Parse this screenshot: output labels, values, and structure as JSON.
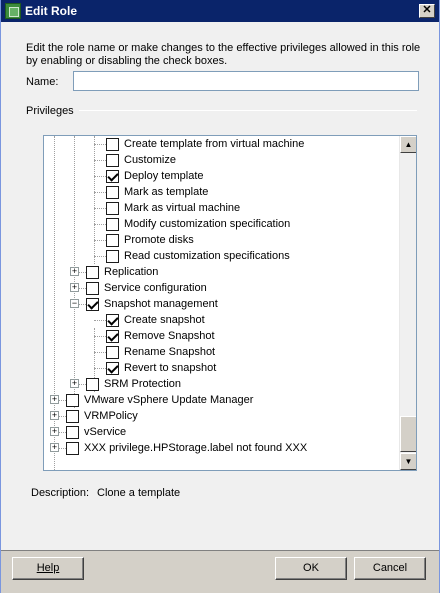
{
  "window": {
    "title": "Edit Role",
    "close_glyph": "✕"
  },
  "intro_text": "Edit the role name or make changes to the effective privileges allowed in this role by enabling or disabling the check boxes.",
  "name_field": {
    "label": "Name:",
    "value": ""
  },
  "privileges_label": "Privileges",
  "tree": {
    "items": [
      {
        "label": "Create template from virtual machine",
        "checked": false
      },
      {
        "label": "Customize",
        "checked": false
      },
      {
        "label": "Deploy template",
        "checked": true
      },
      {
        "label": "Mark as template",
        "checked": false
      },
      {
        "label": "Mark as virtual machine",
        "checked": false
      },
      {
        "label": "Modify customization specification",
        "checked": false
      },
      {
        "label": "Promote disks",
        "checked": false
      },
      {
        "label": "Read customization specifications",
        "checked": false
      },
      {
        "label": "Replication",
        "checked": false,
        "expander": "+"
      },
      {
        "label": "Service configuration",
        "checked": false,
        "expander": "+"
      },
      {
        "label": "Snapshot management",
        "checked": true,
        "expander": "−"
      },
      {
        "label": "Create snapshot",
        "checked": true
      },
      {
        "label": "Remove Snapshot",
        "checked": true
      },
      {
        "label": "Rename Snapshot",
        "checked": false
      },
      {
        "label": "Revert to snapshot",
        "checked": true
      },
      {
        "label": "SRM Protection",
        "checked": false,
        "expander": "+"
      },
      {
        "label": "VMware vSphere Update Manager",
        "checked": false,
        "expander": "+"
      },
      {
        "label": "VRMPolicy",
        "checked": false,
        "expander": "+"
      },
      {
        "label": "vService",
        "checked": false,
        "expander": "+"
      },
      {
        "label": "XXX privilege.HPStorage.label not found XXX",
        "checked": false,
        "expander": "+"
      }
    ]
  },
  "description": {
    "label": "Description:",
    "value": "Clone a template"
  },
  "buttons": {
    "help": "Help",
    "ok": "OK",
    "cancel": "Cancel"
  },
  "scroll_arrows": {
    "up": "▲",
    "down": "▼"
  }
}
